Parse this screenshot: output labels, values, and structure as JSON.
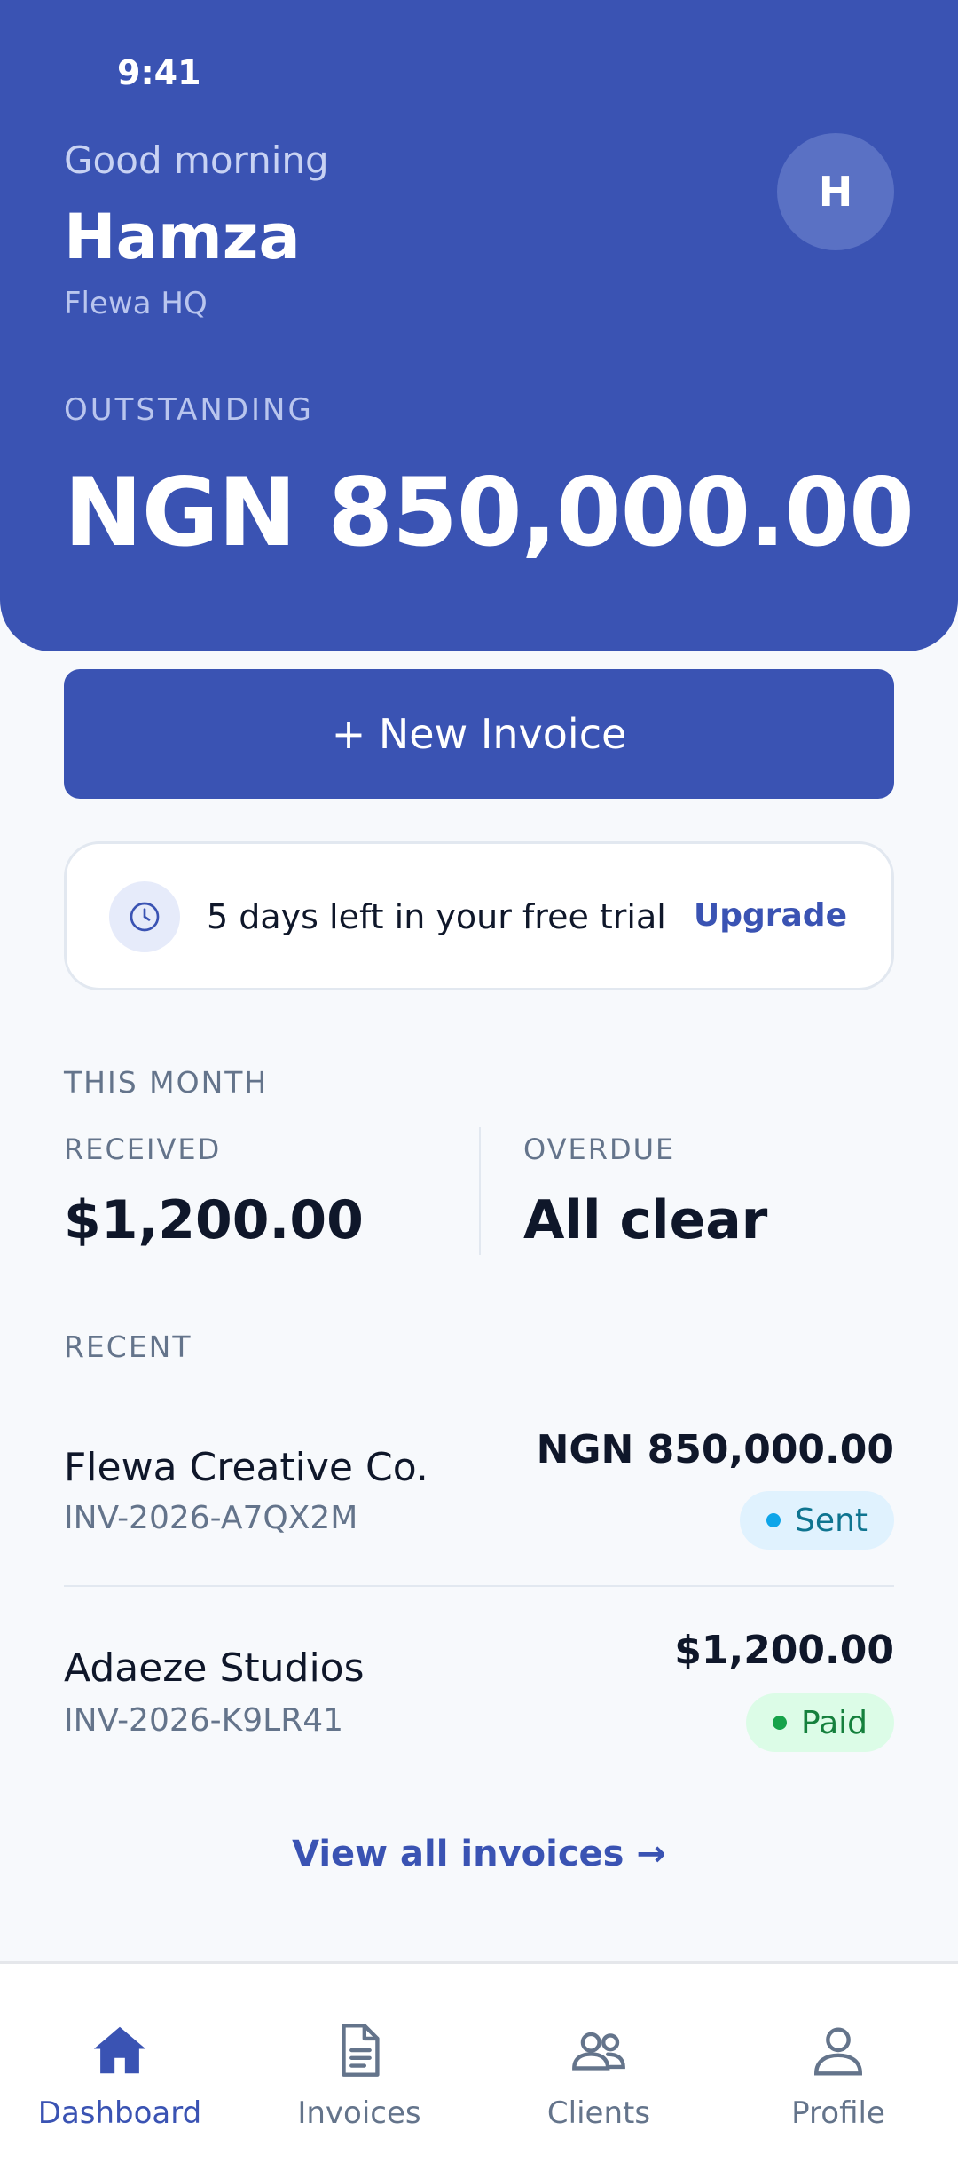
{
  "status_bar": {
    "time": "9:41"
  },
  "header": {
    "greeting": "Good morning",
    "user_name": "Hamza",
    "org_name": "Flewa HQ",
    "avatar_initial": "H",
    "outstanding_label": "OUTSTANDING",
    "outstanding_amount": "NGN 850,000.00"
  },
  "actions": {
    "new_invoice_label": "+ New Invoice"
  },
  "trial": {
    "icon": "clock-icon",
    "message": "5 days left in your free trial",
    "upgrade_label": "Upgrade"
  },
  "this_month": {
    "section_label": "THIS MONTH",
    "received_label": "RECEIVED",
    "received_value": "$1,200.00",
    "overdue_label": "OVERDUE",
    "overdue_value": "All clear"
  },
  "recent": {
    "section_label": "RECENT",
    "items": [
      {
        "client": "Flewa Creative Co.",
        "invoice_id": "INV-2026-A7QX2M",
        "amount": "NGN 850,000.00",
        "status": "Sent",
        "status_color": "#0e7490",
        "status_bg": "#e0f2fe",
        "status_dot": "#0ea5e9"
      },
      {
        "client": "Adaeze Studios",
        "invoice_id": "INV-2026-K9LR41",
        "amount": "$1,200.00",
        "status": "Paid",
        "status_color": "#15803d",
        "status_bg": "#dcfce7",
        "status_dot": "#16a34a"
      }
    ],
    "view_all_label": "View all invoices →"
  },
  "bottom_nav": {
    "active": "Dashboard",
    "items": [
      {
        "label": "Dashboard",
        "icon": "home-icon"
      },
      {
        "label": "Invoices",
        "icon": "document-icon"
      },
      {
        "label": "Clients",
        "icon": "users-icon"
      },
      {
        "label": "Profile",
        "icon": "user-icon"
      }
    ]
  },
  "colors": {
    "brand": "#3a53b3",
    "background": "#f7f9fc",
    "muted_text": "#64748b"
  }
}
